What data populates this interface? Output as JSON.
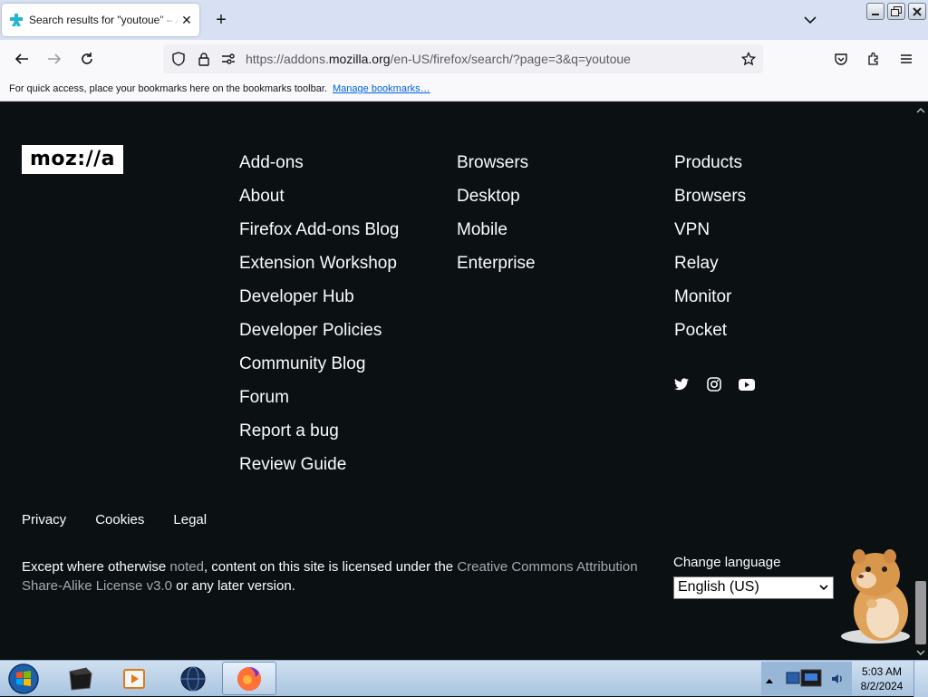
{
  "browser": {
    "tab_title": "Search results for \"youtoue\" – Add-ons for Firefox",
    "url_prefix": "https://addons.",
    "url_host": "mozilla.org",
    "url_path": "/en-US/firefox/search/?page=3&q=youtoue",
    "bookmarks_message": "For quick access, place your bookmarks here on the bookmarks toolbar.",
    "manage_bookmarks": "Manage bookmarks…"
  },
  "footer": {
    "logo": "moz://a",
    "col1": [
      "Add-ons",
      "About",
      "Firefox Add-ons Blog",
      "Extension Workshop",
      "Developer Hub",
      "Developer Policies",
      "Community Blog",
      "Forum",
      "Report a bug",
      "Review Guide"
    ],
    "col2": [
      "Browsers",
      "Desktop",
      "Mobile",
      "Enterprise"
    ],
    "col3": [
      "Products",
      "Browsers",
      "VPN",
      "Relay",
      "Monitor",
      "Pocket"
    ],
    "legal": [
      "Privacy",
      "Cookies",
      "Legal"
    ],
    "license": {
      "part1": "Except where otherwise ",
      "link1": "noted",
      "part2": ", content on this site is licensed under the ",
      "link2": "Creative Commons Attribution Share-Alike License v3.0",
      "part3": " or any later version."
    },
    "language_label": "Change language",
    "language_value": "English (US)"
  },
  "taskbar": {
    "time": "5:03 AM",
    "date": "8/2/2024"
  },
  "colors": {
    "page_bg": "#0b1112",
    "link": "#fbfbfe",
    "muted_link": "#a8a8b3",
    "tabbar": "#d7e1f3"
  }
}
